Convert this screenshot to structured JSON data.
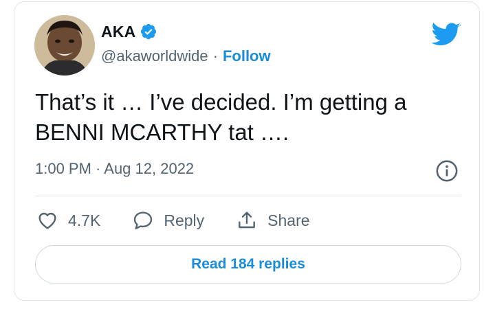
{
  "author": {
    "display_name": "AKA",
    "handle": "@akaworldwide",
    "separator": "·",
    "follow_label": "Follow",
    "verified": true
  },
  "tweet": {
    "text": "That’s it … I’ve decided. I’m getting a\nBENNI MCARTHY tat ….",
    "timestamp": "1:00 PM · Aug 12, 2022"
  },
  "actions": {
    "likes_count": "4.7K",
    "reply_label": "Reply",
    "share_label": "Share"
  },
  "footer": {
    "read_replies_label": "Read 184 replies"
  },
  "colors": {
    "twitter_blue": "#1d9bf0",
    "link_blue": "#1a8cd8",
    "secondary_text": "#536471",
    "border": "#dfe5ea"
  },
  "icons": [
    "verified-badge-icon",
    "twitter-bird-icon",
    "info-icon",
    "heart-icon",
    "reply-bubble-icon",
    "share-icon"
  ]
}
